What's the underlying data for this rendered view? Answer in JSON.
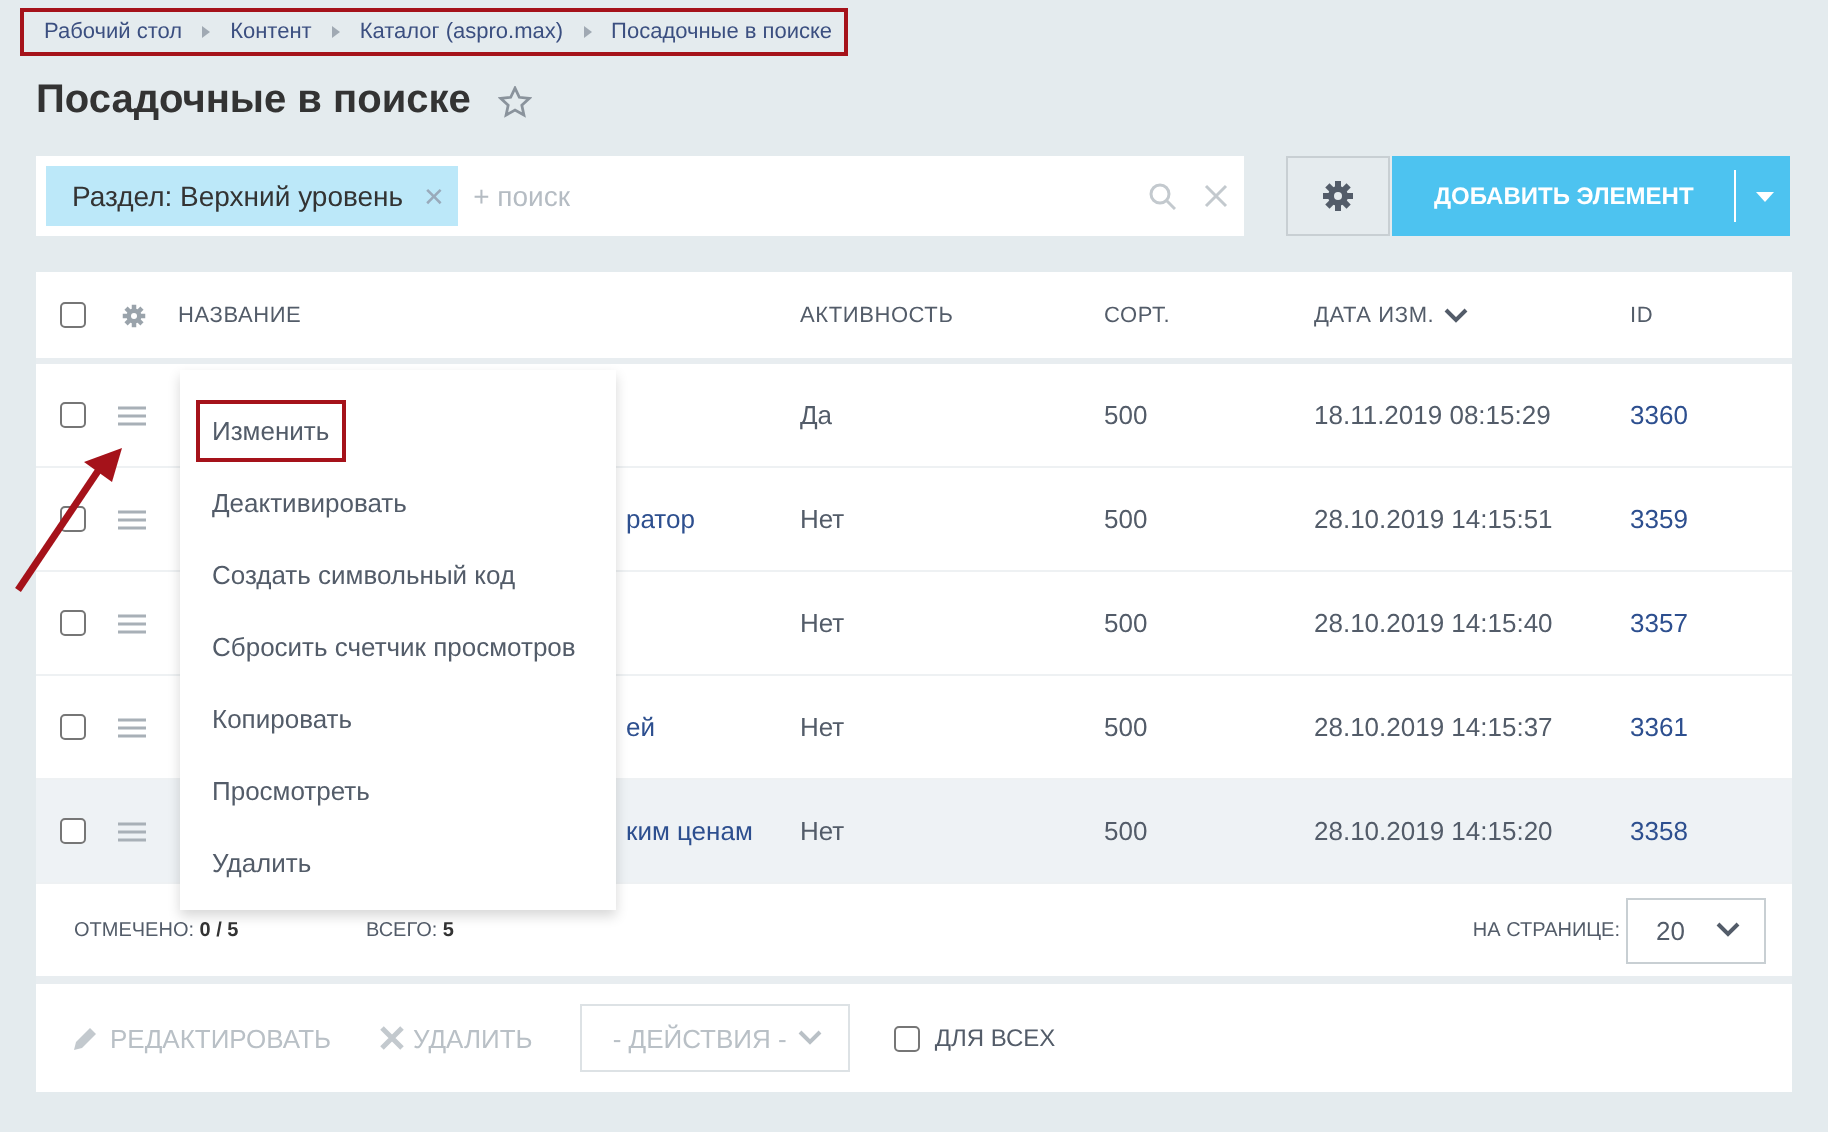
{
  "breadcrumbs": {
    "highlighted": true,
    "items": [
      "Рабочий стол",
      "Контент",
      "Каталог (aspro.max)",
      "Посадочные в поиске"
    ]
  },
  "title": "Посадочные в поиске",
  "filter": {
    "tag": "Раздел: Верхний уровень",
    "tag_remove": "✕",
    "placeholder": "+ поиск"
  },
  "add_button": "ДОБАВИТЬ ЭЛЕМЕНТ",
  "table": {
    "all_checked": false,
    "columns": [
      "НАЗВАНИЕ",
      "АКТИВНОСТЬ",
      "СОРТ.",
      "ДАТА ИЗМ.",
      "ID"
    ],
    "rows": [
      {
        "checked": false,
        "hovered": false,
        "name": "",
        "active": "Да",
        "sort": "500",
        "date": "18.11.2019 08:15:29",
        "id": "3360"
      },
      {
        "checked": false,
        "hovered": false,
        "name": "ратор",
        "active": "Нет",
        "sort": "500",
        "date": "28.10.2019 14:15:51",
        "id": "3359"
      },
      {
        "checked": false,
        "hovered": false,
        "name": "",
        "active": "Нет",
        "sort": "500",
        "date": "28.10.2019 14:15:40",
        "id": "3357"
      },
      {
        "checked": false,
        "hovered": false,
        "name": "ей",
        "active": "Нет",
        "sort": "500",
        "date": "28.10.2019 14:15:37",
        "id": "3361"
      },
      {
        "checked": false,
        "hovered": true,
        "name": "ким ценам",
        "active": "Нет",
        "sort": "500",
        "date": "28.10.2019 14:15:20",
        "id": "3358"
      }
    ]
  },
  "context_menu": [
    {
      "label": "Изменить",
      "highlighted": true
    },
    {
      "label": "Деактивировать",
      "highlighted": false
    },
    {
      "label": "Создать символьный код",
      "highlighted": false
    },
    {
      "label": "Сбросить счетчик просмотров",
      "highlighted": false
    },
    {
      "label": "Копировать",
      "highlighted": false
    },
    {
      "label": "Просмотреть",
      "highlighted": false
    },
    {
      "label": "Удалить",
      "highlighted": false
    }
  ],
  "footer": {
    "checked_label": "ОТМЕЧЕНО:",
    "checked_value": "0 / 5",
    "total_label": "ВСЕГО:",
    "total_value": "5",
    "per_page_label": "НА СТРАНИЦЕ:",
    "per_page": "20"
  },
  "actions": {
    "edit": "РЕДАКТИРОВАТЬ",
    "delete": "УДАЛИТЬ",
    "select": "- ДЕЙСТВИЯ -",
    "for_all": "ДЛЯ ВСЕХ",
    "for_all_checked": false
  }
}
